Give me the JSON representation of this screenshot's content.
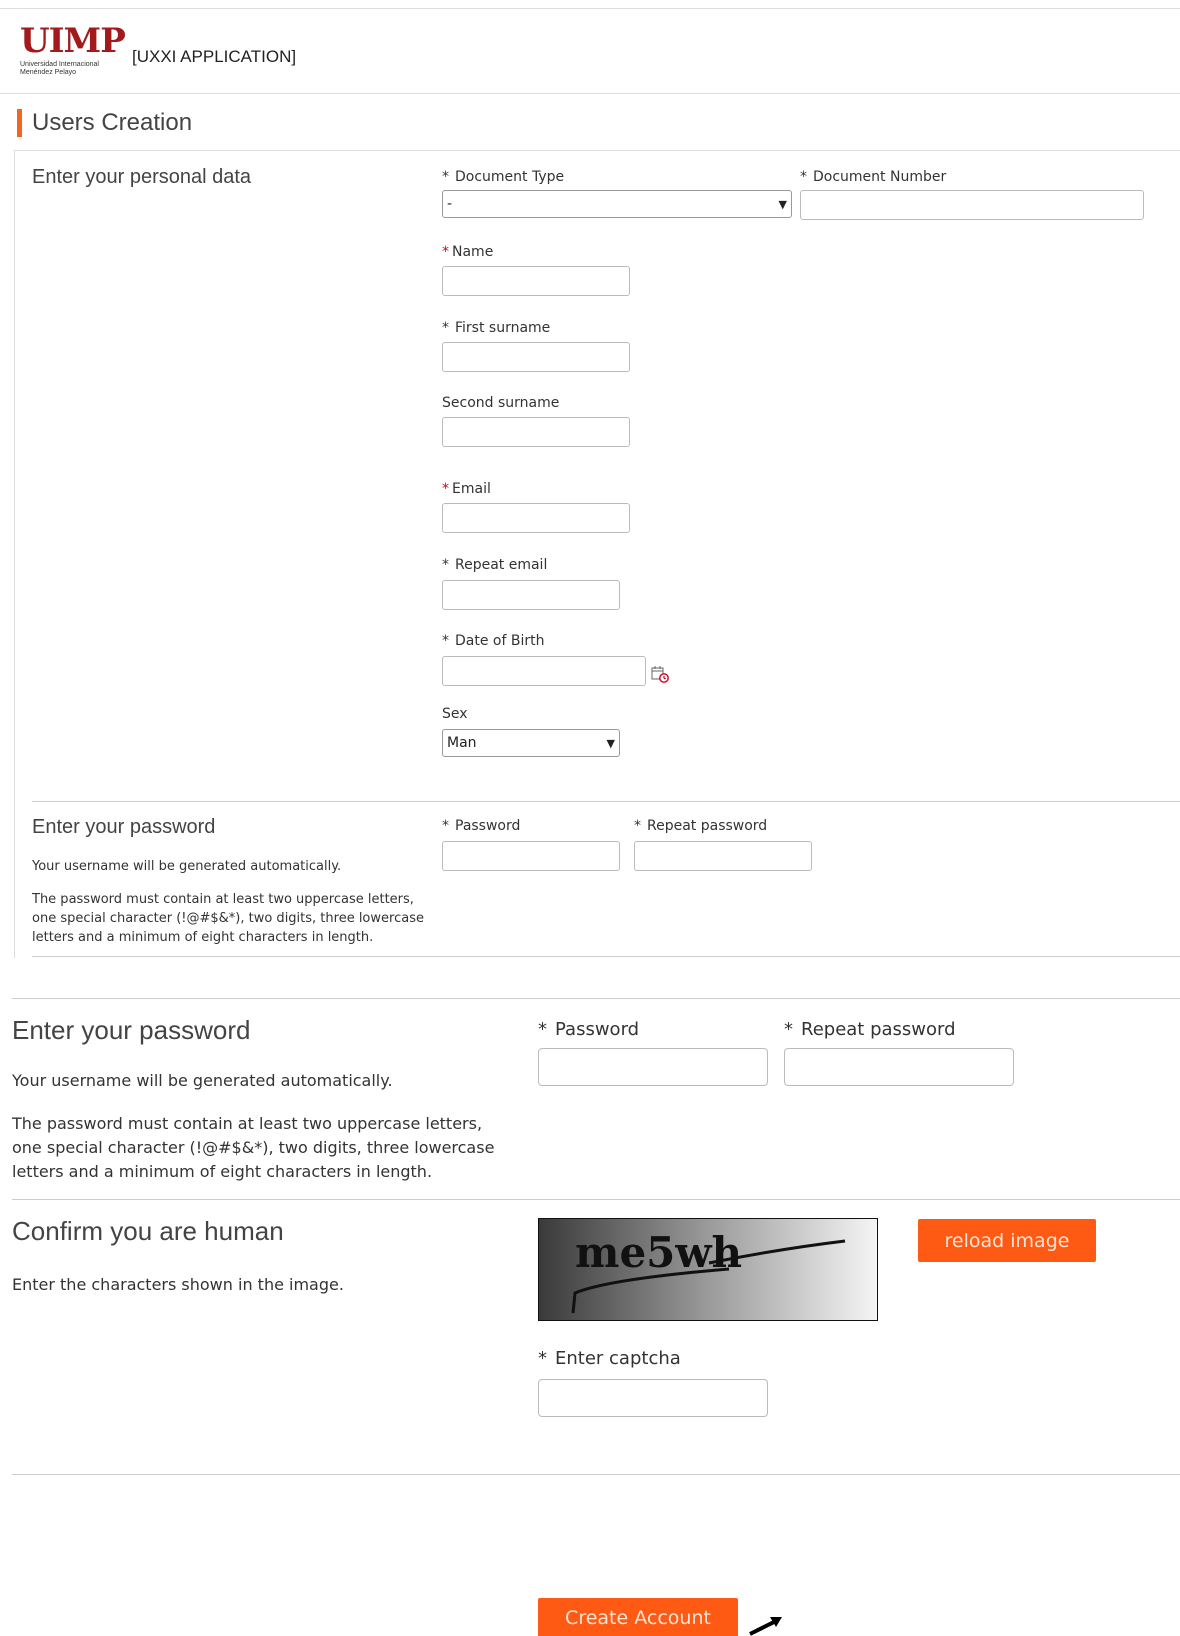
{
  "header": {
    "logo_text": "UIMP",
    "logo_subtitle": "Universidad Internacional Menéndez Pelayo",
    "app_name": "[UXXI APPLICATION]"
  },
  "page_title": "Users Creation",
  "personal": {
    "heading": "Enter your personal data",
    "document_type": {
      "label": "Document Type",
      "value": "-"
    },
    "document_number": {
      "label": "Document Number",
      "value": ""
    },
    "name": {
      "label": "Name",
      "value": ""
    },
    "first_surname": {
      "label": "First surname",
      "value": ""
    },
    "second_surname": {
      "label": "Second surname",
      "value": ""
    },
    "email": {
      "label": "Email",
      "value": ""
    },
    "repeat_email": {
      "label": "Repeat email",
      "value": ""
    },
    "dob": {
      "label": "Date of Birth",
      "value": ""
    },
    "sex": {
      "label": "Sex",
      "value": "Man"
    }
  },
  "password_small": {
    "heading": "Enter your password",
    "note1": "Your username will be generated automatically.",
    "note2": "The password must contain at least two uppercase letters, one special character (!@#$&*), two digits, three lowercase letters and a minimum of eight characters in length.",
    "password_label": "Password",
    "repeat_label": "Repeat password"
  },
  "password_large": {
    "heading": "Enter your password",
    "note1": "Your username will be generated automatically.",
    "note2": "The password must contain at least two uppercase letters, one special character (!@#$&*), two digits, three lowercase letters and a minimum of eight characters in length.",
    "password_label": "Password",
    "repeat_label": "Repeat password"
  },
  "captcha": {
    "heading": "Confirm you are human",
    "instruction": "Enter the characters shown in the image.",
    "image_text": "me5wh",
    "reload_label": "reload image",
    "input_label": "Enter captcha"
  },
  "create_button": "Create Account",
  "required_mark": "*",
  "colors": {
    "accent": "#ff5a14",
    "brand": "#a3191c",
    "required_red": "#d0021b"
  },
  "icons": {
    "calendar": "calendar-icon",
    "dropdown": "chevron-down-icon"
  }
}
